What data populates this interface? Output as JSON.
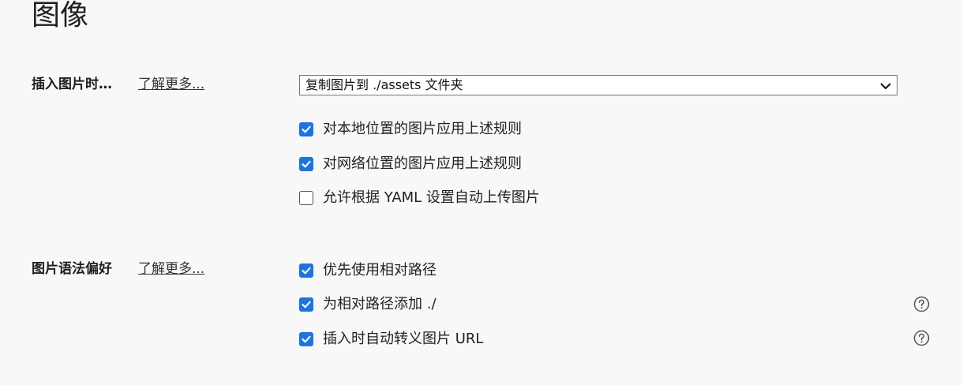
{
  "page": {
    "title": "图像"
  },
  "insert_section": {
    "label": "插入图片时…",
    "learn_more": "了解更多..."
  },
  "insert_select": {
    "value": "复制图片到 ./assets 文件夹"
  },
  "insert_options": [
    {
      "label": "对本地位置的图片应用上述规则",
      "checked": true
    },
    {
      "label": "对网络位置的图片应用上述规则",
      "checked": true
    },
    {
      "label": "允许根据 YAML 设置自动上传图片",
      "checked": false
    }
  ],
  "syntax_section": {
    "label": "图片语法偏好",
    "learn_more": "了解更多..."
  },
  "syntax_options": [
    {
      "label": "优先使用相对路径",
      "checked": true,
      "help": false
    },
    {
      "label": "为相对路径添加 ./",
      "checked": true,
      "help": true
    },
    {
      "label": "插入时自动转义图片 URL",
      "checked": true,
      "help": true
    }
  ],
  "colors": {
    "accent": "#1a73e8",
    "background": "#f8f8f8"
  }
}
